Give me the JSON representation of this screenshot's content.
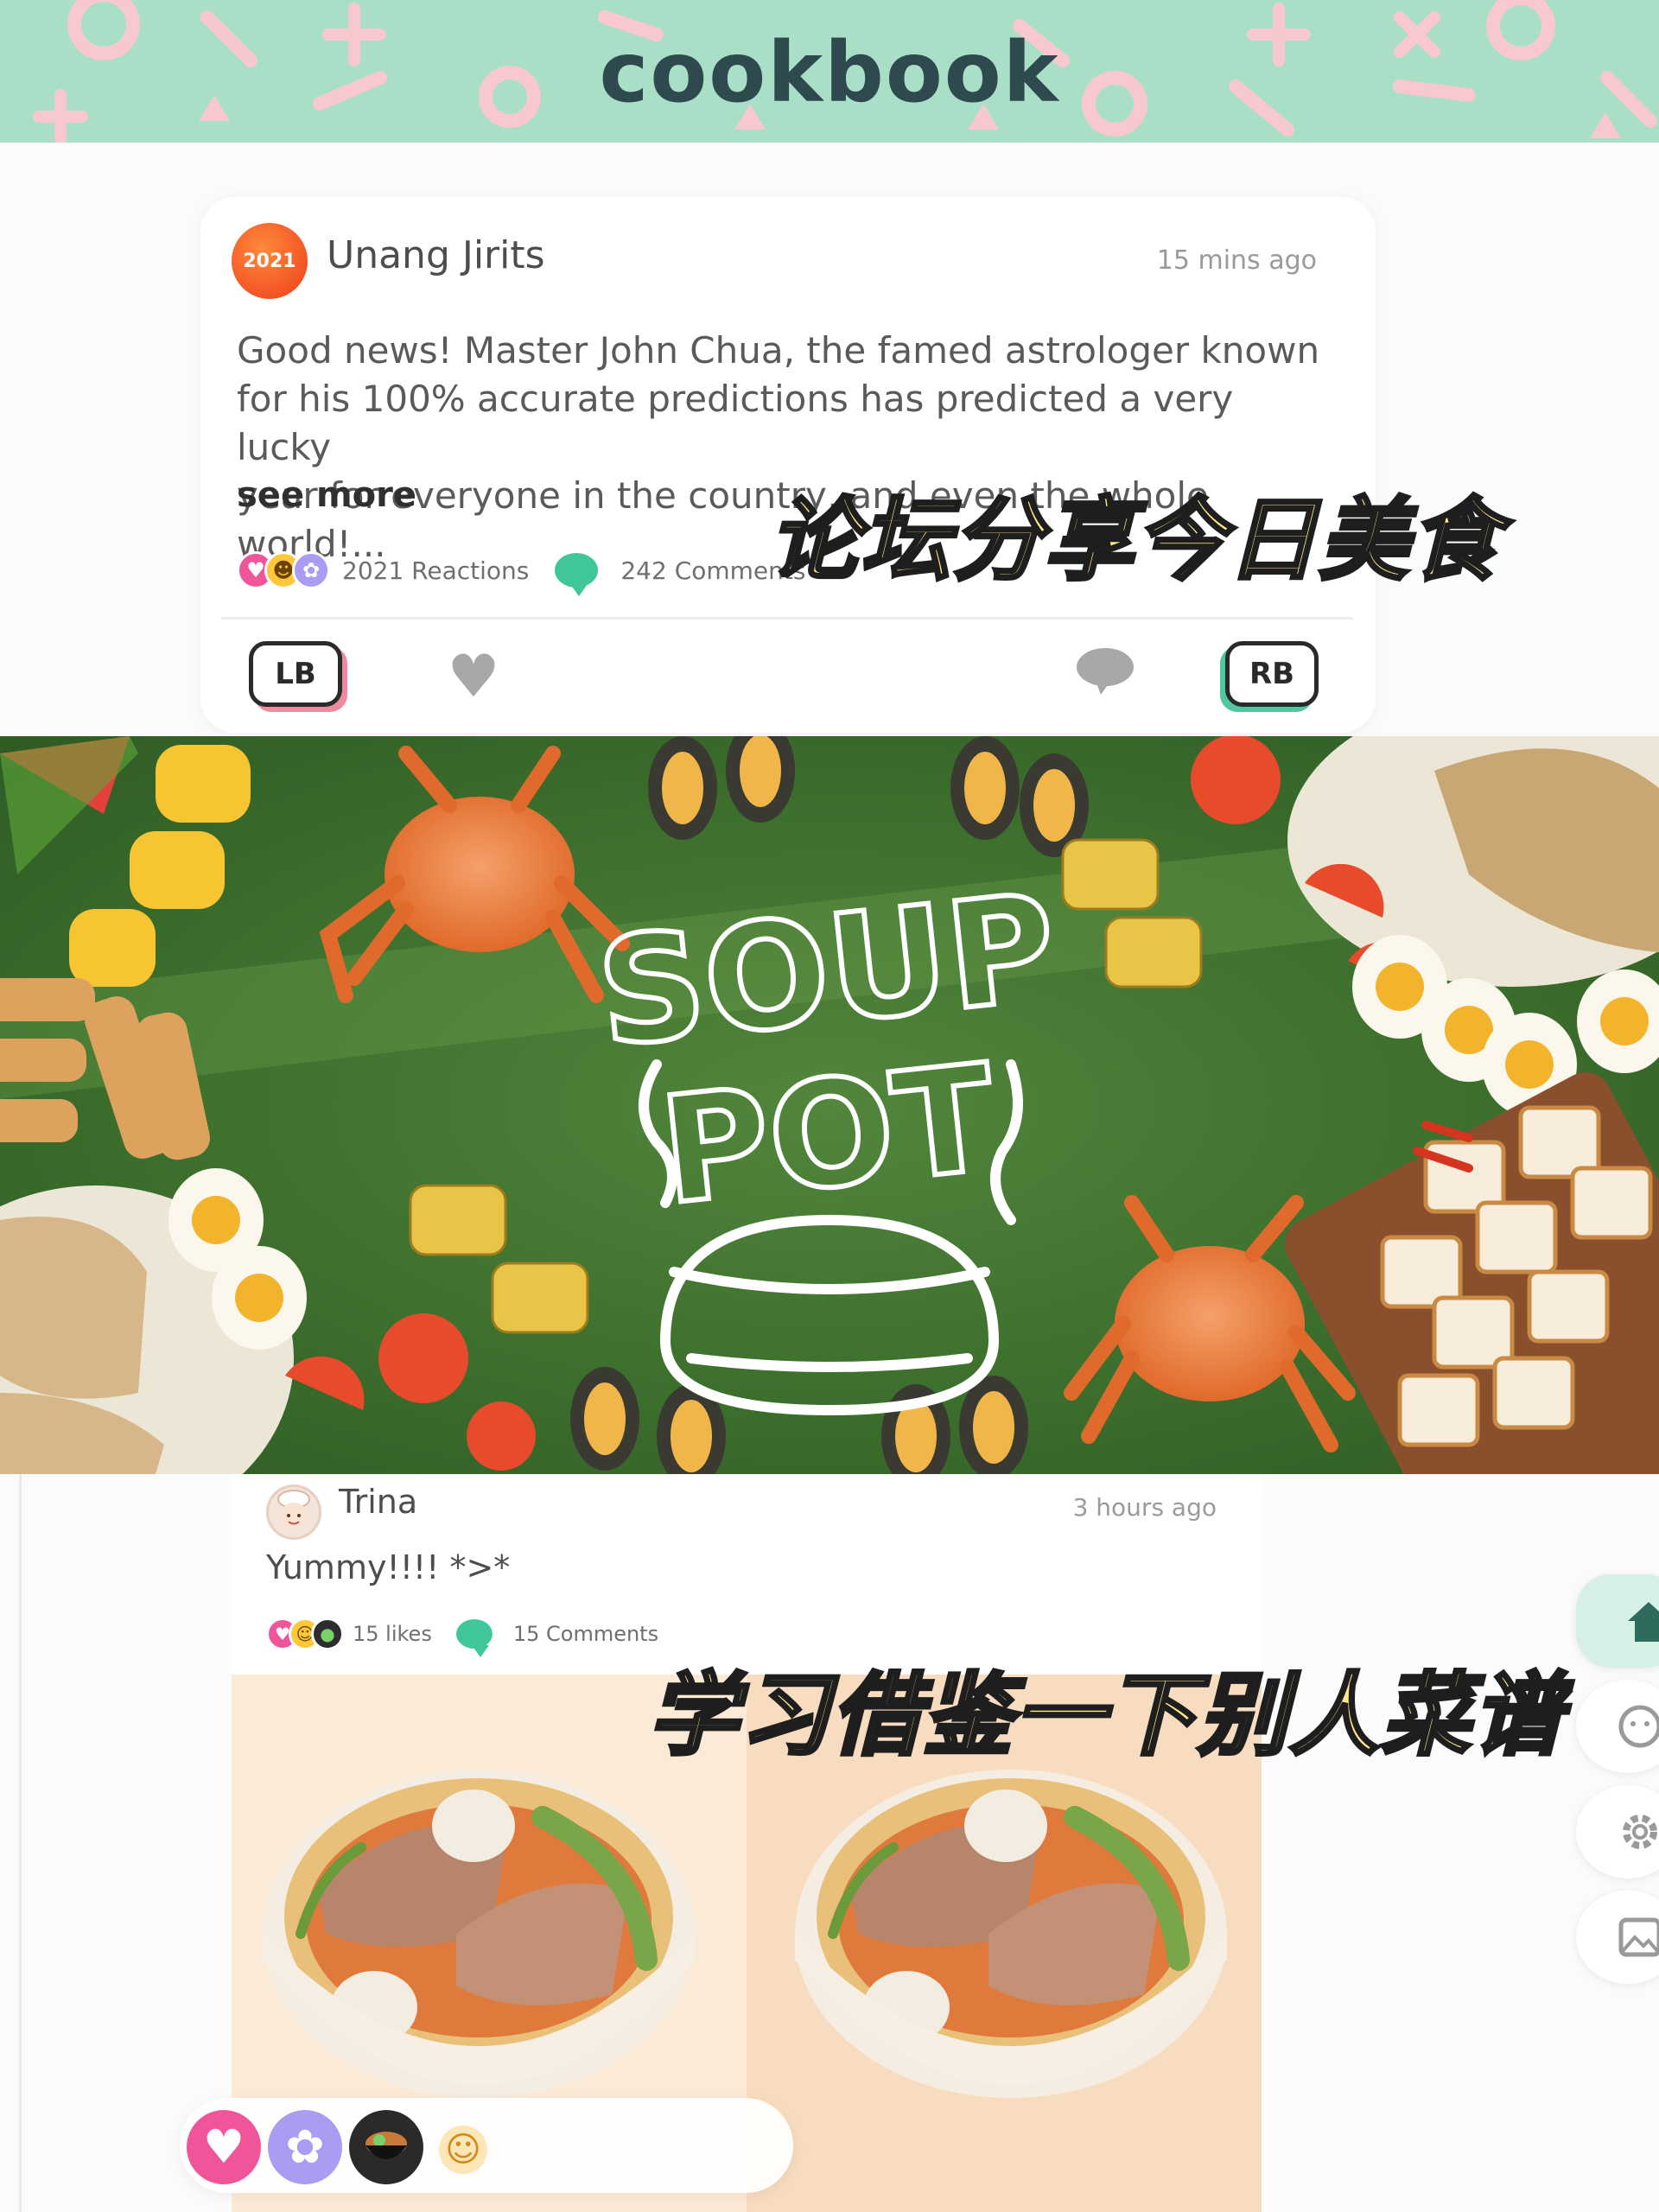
{
  "app": {
    "title": "cookbook"
  },
  "post1": {
    "author": "Unang Jirits",
    "avatar_text": "2021",
    "time": "15 mins ago",
    "body": "Good news! Master John Chua, the famed astrologer known\nfor his 100% accurate predictions has predicted a very lucky\nyear for everyone in the country, and even the whole world!...",
    "see_more": "see more",
    "reactions_label": "2021 Reactions",
    "comments_label": "242 Comments",
    "reaction_icons": [
      "heart-icon",
      "laugh-icon",
      "flower-icon"
    ]
  },
  "controls": {
    "left_bumper": "LB",
    "right_bumper": "RB"
  },
  "overlay": {
    "caption_top": "论坛分享今日美食",
    "caption_bottom": "学习借鉴一下别人菜谱"
  },
  "banner": {
    "logo_line1": "SOUP",
    "logo_line2": "POT"
  },
  "post2": {
    "author": "Trina",
    "time": "3 hours ago",
    "message": "Yummy!!!! *>*",
    "likes_label": "15 likes",
    "comments_label": "15 Comments",
    "reaction_icons": [
      "heart-icon",
      "smile-icon",
      "stew-icon"
    ]
  },
  "reaction_bar": {
    "items": [
      "heart-icon",
      "flower-icon",
      "stew-icon",
      "smile-icon"
    ]
  },
  "side_rail": {
    "items": [
      "home-icon",
      "face-icon",
      "gear-icon",
      "photo-icon"
    ]
  },
  "colors": {
    "header_bg": "#a9dfc6",
    "header_title": "#2e4a4f",
    "accent_green": "#3fc79a",
    "accent_pink": "#f08aa0",
    "banner_green": "#3b6d2c",
    "caption_yellow": "#ffe88a"
  }
}
